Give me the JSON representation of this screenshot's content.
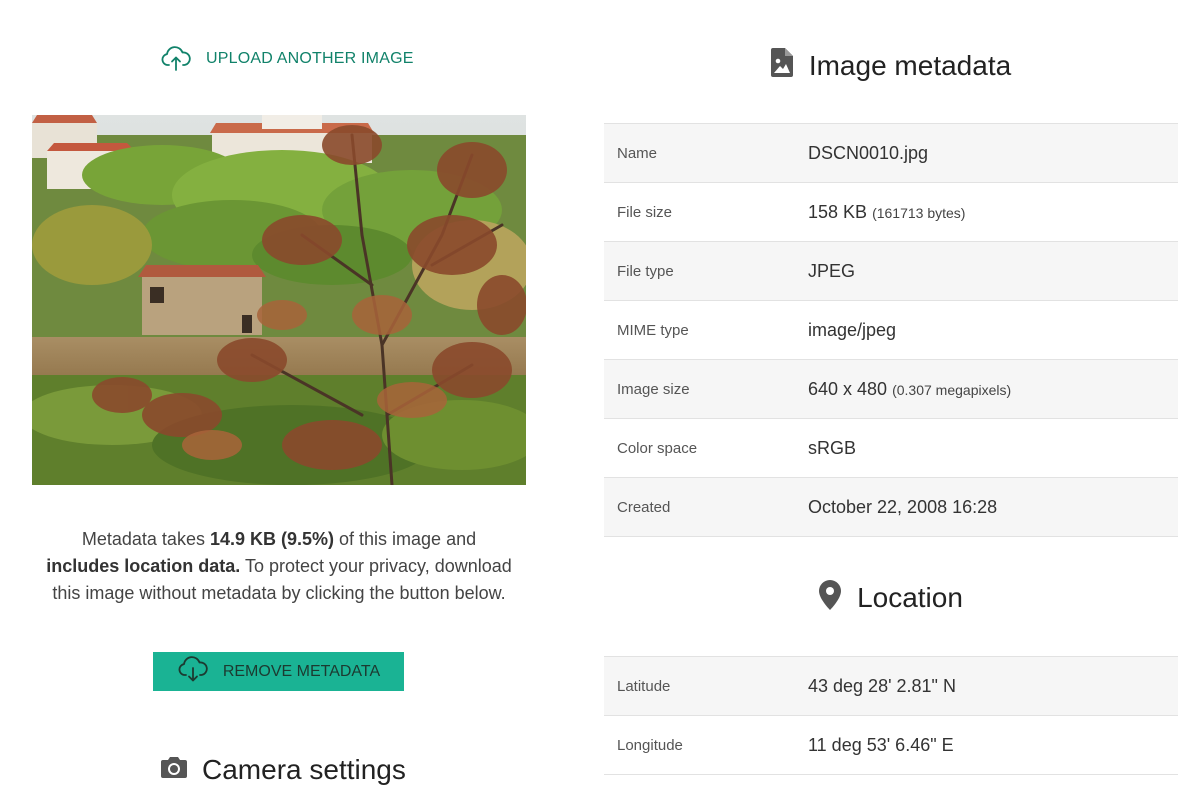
{
  "upload": {
    "label": "UPLOAD ANOTHER IMAGE"
  },
  "notice": {
    "prefix": "Metadata takes ",
    "size": "14.9 KB (9.5%)",
    "middle": " of this image and ",
    "location_flag": "includes location data.",
    "suffix": " To protect your privacy, download this image without metadata by clicking the button below."
  },
  "remove_button": {
    "label": "REMOVE METADATA"
  },
  "camera_section": {
    "title": "Camera settings"
  },
  "metadata_section": {
    "title": "Image metadata",
    "rows": [
      {
        "key": "Name",
        "value": "DSCN0010.jpg",
        "extra": ""
      },
      {
        "key": "File size",
        "value": "158 KB",
        "extra": "(161713 bytes)"
      },
      {
        "key": "File type",
        "value": "JPEG",
        "extra": ""
      },
      {
        "key": "MIME type",
        "value": "image/jpeg",
        "extra": ""
      },
      {
        "key": "Image size",
        "value": "640 x 480",
        "extra": "(0.307 megapixels)"
      },
      {
        "key": "Color space",
        "value": "sRGB",
        "extra": ""
      },
      {
        "key": "Created",
        "value": "October 22, 2008 16:28",
        "extra": ""
      }
    ]
  },
  "location_section": {
    "title": "Location",
    "rows": [
      {
        "key": "Latitude",
        "value": "43 deg 28' 2.81\" N"
      },
      {
        "key": "Longitude",
        "value": "11 deg 53' 6.46\" E"
      }
    ]
  },
  "icons": {
    "upload": "cloud-upload-icon",
    "download": "cloud-download-icon",
    "camera": "camera-icon",
    "image_file": "image-file-icon",
    "location": "map-pin-icon"
  },
  "colors": {
    "accent": "#11826a",
    "button": "#1ab394",
    "row_stripe": "#f6f6f6",
    "row_border": "#e2e2e2"
  }
}
